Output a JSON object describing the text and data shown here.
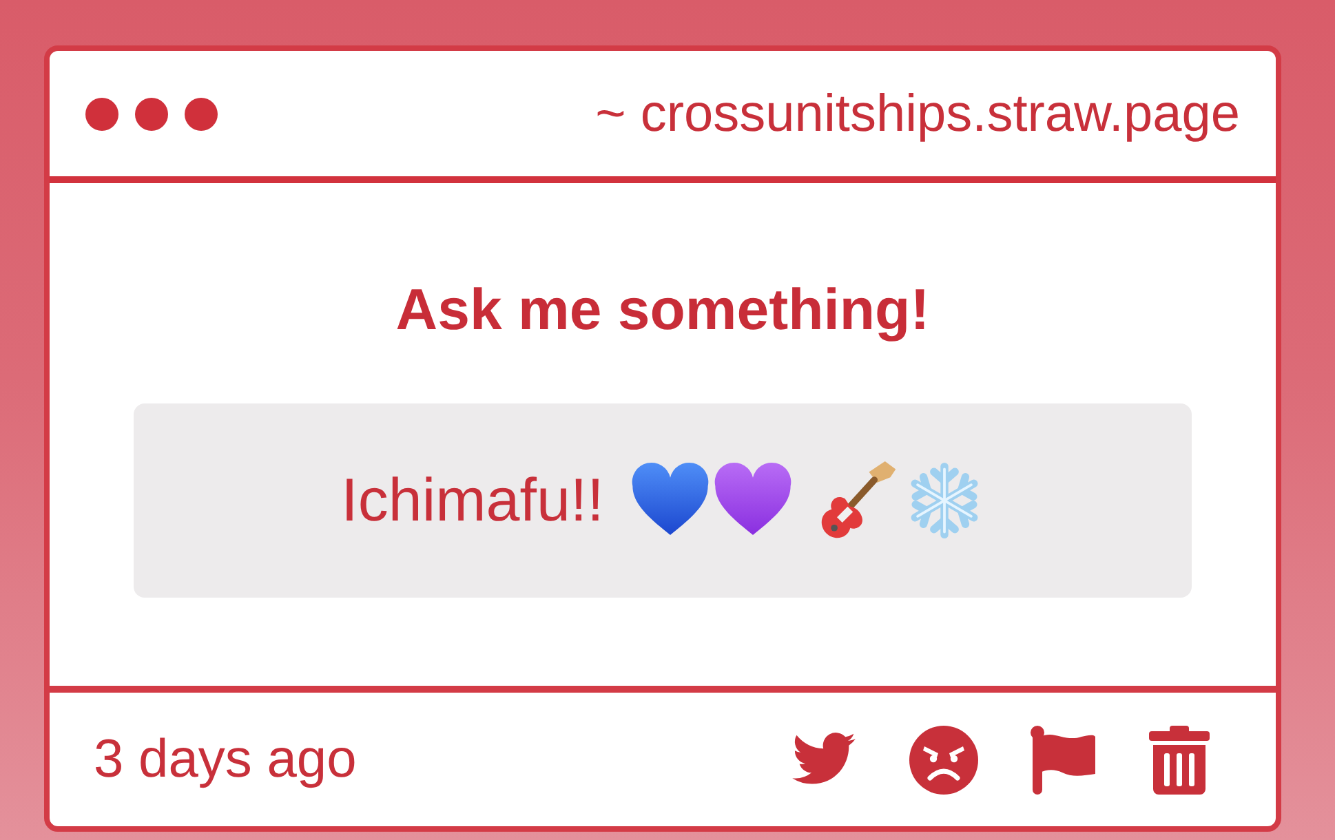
{
  "window": {
    "title": "~ crossunitships.straw.page"
  },
  "prompt": {
    "title": "Ask me something!"
  },
  "answer": {
    "text": "Ichimafu!!"
  },
  "footer": {
    "time": "3 days ago"
  }
}
